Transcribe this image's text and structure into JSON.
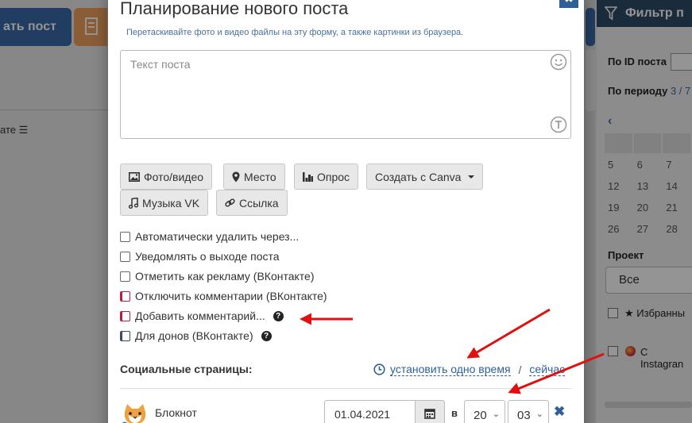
{
  "background": {
    "create_post_label": "ать пост",
    "sort_label": "ате"
  },
  "filter": {
    "title": "Фильтр п",
    "by_id_label": "По ID поста",
    "by_period_label": "По периоду",
    "period_value": "3 / 7",
    "calendar_rows": [
      [
        "",
        "",
        ""
      ],
      [
        "5",
        "6",
        "7"
      ],
      [
        "12",
        "13",
        "14"
      ],
      [
        "19",
        "20",
        "21"
      ],
      [
        "26",
        "27",
        "28"
      ]
    ],
    "project_label": "Проект",
    "project_value": "Все",
    "favorites_label": "Избранны",
    "instagram_label": "С Instagran"
  },
  "modal": {
    "title": "Планирование нового поста",
    "subtitle": "Перетаскивайте фото и видео файлы на эту форму, а также картинки из браузера.",
    "close_label": "✖",
    "text_placeholder": "Текст поста",
    "buttons": {
      "photo_video": "Фото/видео",
      "place": "Место",
      "poll": "Опрос",
      "canva": "Создать с Canva",
      "music": "Музыка VK",
      "link": "Ссылка"
    },
    "options": [
      "Автоматически удалить через...",
      "Уведомлять о выходе поста",
      "Отметить как рекламу (ВКонтакте)",
      "Отключить комментарии (ВКонтакте)",
      "Добавить комментарий...",
      "Для донов (ВКонтакте)"
    ],
    "social_label": "Социальные страницы:",
    "set_one_time": "установить одно время",
    "separator": "/",
    "now": "сейчас",
    "account": {
      "name": "Блокнот",
      "date": "01.04.2021",
      "at_label": "в",
      "hour": "20",
      "minute": "03"
    }
  },
  "colors": {
    "accent_blue": "#2e5f96",
    "annotation_red": "#e01010",
    "filter_header": "#2e4a66"
  },
  "icons": {
    "photo": "image-icon",
    "place": "map-marker-icon",
    "poll": "bar-chart-icon",
    "music": "music-note-icon",
    "link": "link-icon",
    "clock": "clock-icon",
    "calendar": "calendar-icon",
    "emoji": "smile-icon",
    "format": "text-format-icon",
    "filter": "funnel-icon"
  }
}
